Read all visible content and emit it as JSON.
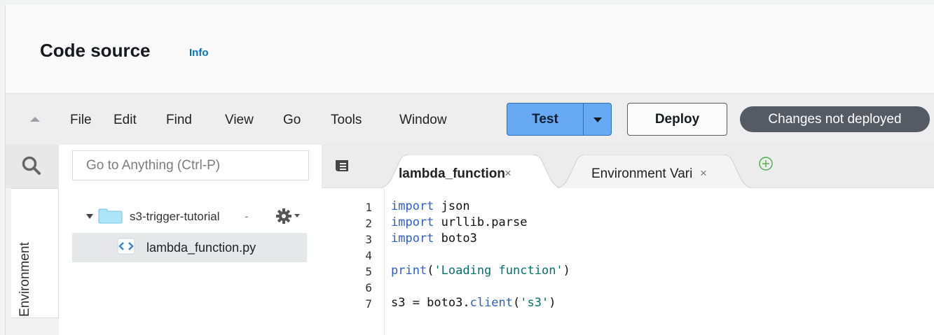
{
  "header": {
    "title": "Code source",
    "info_link": "Info"
  },
  "menubar": {
    "items": [
      "File",
      "Edit",
      "Find",
      "View",
      "Go",
      "Tools",
      "Window"
    ],
    "test_label": "Test",
    "deploy_label": "Deploy",
    "status": "Changes not deployed"
  },
  "sidebar": {
    "search_placeholder": "Go to Anything (Ctrl-P)",
    "environment_tab": "Environment",
    "folder_name": "s3-trigger-tutorial",
    "folder_suffix": "-",
    "file_name": "lambda_function.py"
  },
  "editor": {
    "tabs": [
      {
        "label": "lambda_function",
        "close": "×",
        "active": true
      },
      {
        "label": "Environment Vari",
        "close": "×",
        "active": false
      }
    ],
    "line_numbers": [
      "1",
      "2",
      "3",
      "4",
      "5",
      "6",
      "7"
    ],
    "code": [
      {
        "kw": "import",
        "rest": " json"
      },
      {
        "kw": "import",
        "rest": " urllib.parse"
      },
      {
        "kw": "import",
        "rest": " boto3"
      },
      {
        "kw": "",
        "rest": ""
      },
      {
        "fn": "print",
        "open": "(",
        "str": "'Loading function'",
        "close": ")"
      },
      {
        "kw": "",
        "rest": ""
      },
      {
        "pre": "s3 = boto3.",
        "fn": "client",
        "open": "(",
        "str": "'s3'",
        "close": ")"
      }
    ]
  },
  "colors": {
    "test_button": "#67a9f2",
    "status_badge": "#545b64",
    "info_link": "#0073bb",
    "keyword": "#2e5fc2",
    "string": "#07706b"
  }
}
